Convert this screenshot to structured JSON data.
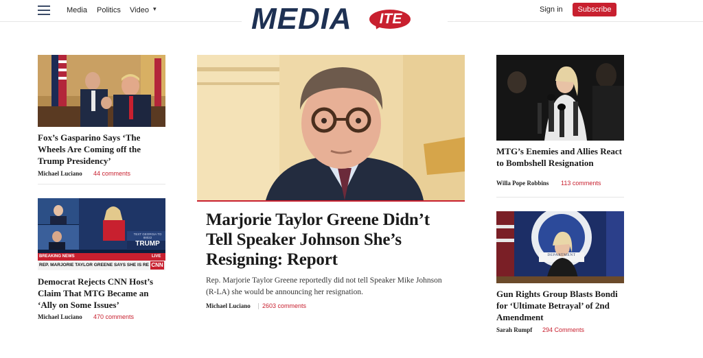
{
  "header": {
    "nav": [
      "Media",
      "Politics",
      "Video"
    ],
    "logo_main": "MEDIA",
    "logo_bubble": "ITE",
    "signin_label": "Sign in",
    "subscribe_label": "Subscribe",
    "accent_color": "#c8202f",
    "brand_color": "#1e3153"
  },
  "left_column": [
    {
      "headline": "Fox’s Gasparino Says ‘The Wheels Are Coming off the Trump Presidency’",
      "author": "Michael Luciano",
      "comments": "44 comments"
    },
    {
      "headline": "Democrat Rejects CNN Host’s Claim That MTG Became an ‘Ally on Some Issues’",
      "author": "Michael Luciano",
      "comments": "470 comments",
      "image_banner_text": "REP. MARJORIE TAYLOR GREENE SAYS SHE IS RESIGNING",
      "image_breaking": "BREAKING NEWS",
      "image_live": "LIVE",
      "image_brand": "CNN",
      "image_tv_label": "TEXT GEORGIA TO 88022",
      "image_tv_word": "TRUMP"
    }
  ],
  "feature": {
    "headline": "Marjorie Taylor Greene Didn’t Tell Speaker Johnson She’s Resigning: Report",
    "dek": "Rep. Marjorie Taylor Greene reportedly did not tell Speaker Mike Johnson (R-LA) she would be announcing her resignation.",
    "author": "Michael Luciano",
    "comments": "2603 comments"
  },
  "right_column": [
    {
      "headline": "MTG’s Enemies and Allies React to Bombshell Resignation",
      "author": "Willa Pope Robbins",
      "comments": "113 comments"
    },
    {
      "headline": "Gun Rights Group Blasts Bondi for ‘Ultimate Betrayal’ of 2nd Amendment",
      "author": "Sarah Rumpf",
      "comments": "294 Comments",
      "image_sign_text": "DEPARTMENT"
    }
  ]
}
